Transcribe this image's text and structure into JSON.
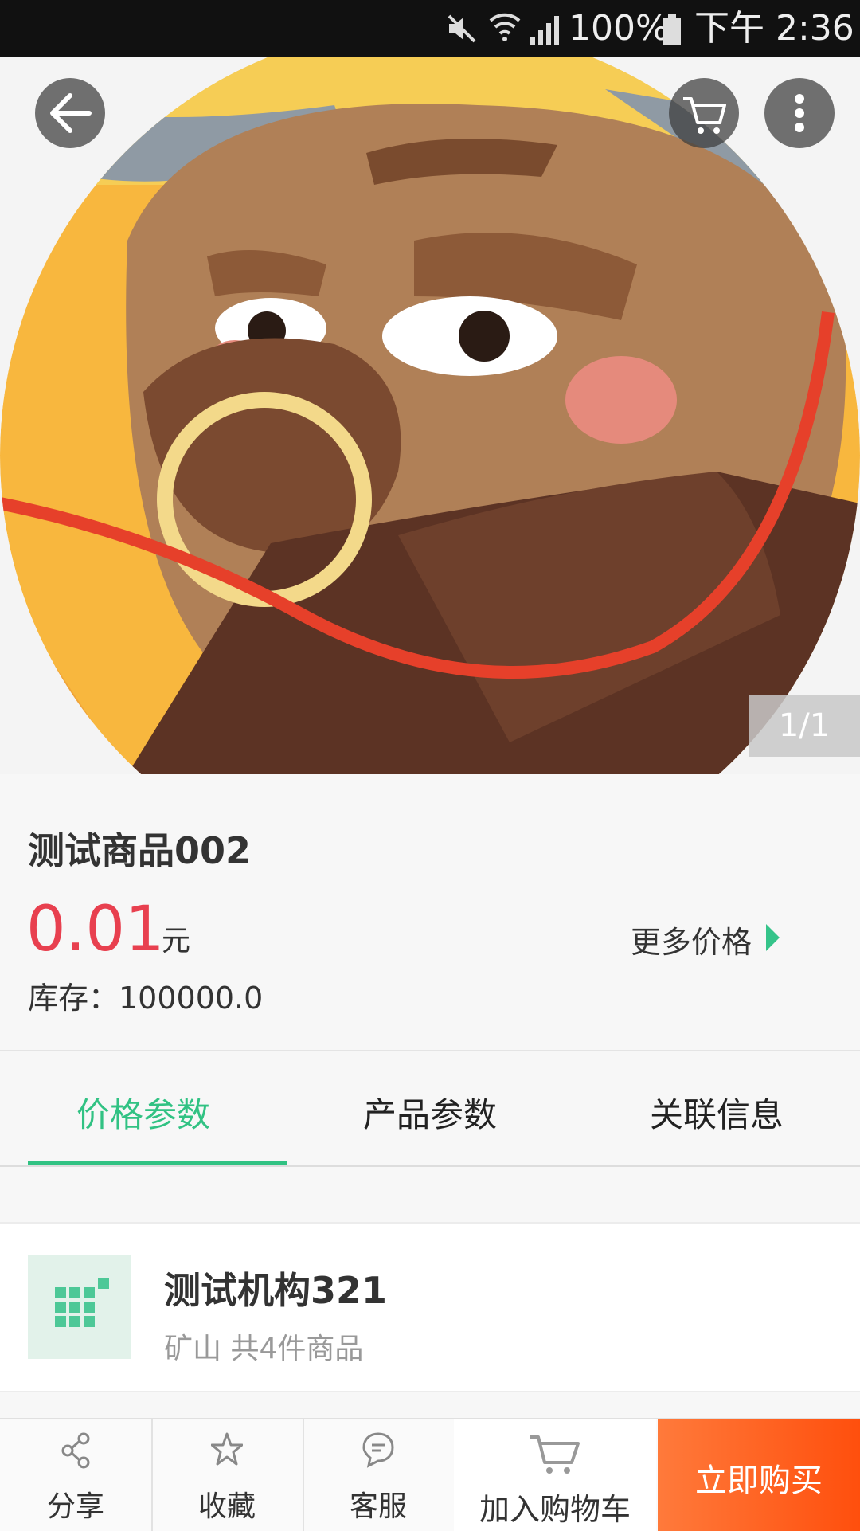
{
  "status_bar": {
    "battery": "100%",
    "time": "下午 2:36"
  },
  "gallery": {
    "counter": "1/1"
  },
  "product": {
    "title": "测试商品002",
    "price": "0.01",
    "unit": "元",
    "more_price": "更多价格",
    "stock": "库存：100000.0"
  },
  "tabs": [
    {
      "label": "价格参数",
      "active": true
    },
    {
      "label": "产品参数",
      "active": false
    },
    {
      "label": "关联信息",
      "active": false
    }
  ],
  "store": {
    "name": "测试机构321",
    "sub": "矿山  共4件商品"
  },
  "bottom_bar": {
    "share": "分享",
    "favorite": "收藏",
    "service": "客服",
    "add_cart": "加入购物车",
    "buy_now": "立即购买"
  },
  "colors": {
    "accent": "#31c283",
    "price": "#e8404f",
    "buy": "#ff5a16"
  }
}
